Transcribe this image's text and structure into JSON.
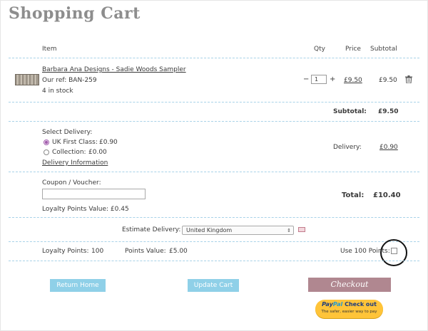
{
  "page_title": "Shopping Cart",
  "columns": {
    "item": "Item",
    "qty": "Qty",
    "price": "Price",
    "subtotal": "Subtotal"
  },
  "item": {
    "name": "Barbara Ana Designs - Sadie Woods Sampler",
    "ref": "Our ref: BAN-259",
    "stock": "4 in stock",
    "qty_minus": "−",
    "qty_value": "1",
    "qty_plus": "+",
    "price": "£9.50",
    "subtotal": "£9.50"
  },
  "subtotal": {
    "label": "Subtotal:",
    "value": "£9.50"
  },
  "delivery": {
    "heading": "Select Delivery:",
    "options": [
      {
        "label": "UK First Class:",
        "price": "£0.90",
        "selected": true
      },
      {
        "label": "Collection:",
        "price": "£0.00",
        "selected": false
      }
    ],
    "info_link": "Delivery Information",
    "label": "Delivery:",
    "value": "£0.90"
  },
  "coupon": {
    "label": "Coupon / Voucher:",
    "value": "",
    "placeholder": ""
  },
  "total": {
    "label": "Total:",
    "value": "£10.40"
  },
  "loyalty_value": "Loyalty Points Value: £0.45",
  "estimate": {
    "label": "Estimate Delivery:",
    "selected": "United Kingdom"
  },
  "points": {
    "loyalty_label": "Loyalty Points:",
    "loyalty_value": "100",
    "points_value_label": "Points Value:",
    "points_value": "£5.00",
    "use_label": "Use 100 Points:"
  },
  "buttons": {
    "return_home": "Return Home",
    "update_cart": "Update Cart",
    "checkout": "Checkout"
  },
  "paypal": {
    "pay": "Pay",
    "pal": "Pal",
    "checkout": "Check out",
    "tagline": "The safer, easier way to pay"
  },
  "colors": {
    "accent_blue": "#8fd0e8",
    "checkout": "#b08790",
    "radio": "#a25cad",
    "paypal": "#ffc439"
  }
}
